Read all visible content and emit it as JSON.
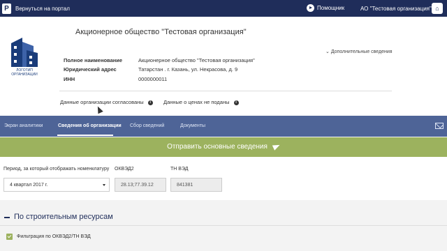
{
  "topbar": {
    "back_label": "Вернуться на портал",
    "helper_label": "Помощник",
    "org_label": "АО \"Тестовая организация\"",
    "logo_letter": "P",
    "user_glyph": "⌂"
  },
  "org": {
    "title": "Акционерное общество \"Тестовая организация\"",
    "logo_caption": "ЛОГОТИП ОРГАНИЗАЦИИ",
    "more_label": "Дополнительные сведения",
    "fields": [
      {
        "key": "Полное наименование",
        "value": "Акционерное общество \"Тестовая организация\""
      },
      {
        "key": "Юридический адрес",
        "value": "Татарстан . г. Казань, ул. Некрасова, д. 9"
      },
      {
        "key": "ИНН",
        "value": "0000000011"
      }
    ],
    "status_agreed": "Данные организации согласованы",
    "status_prices": "Данные о ценах не поданы"
  },
  "tabs": [
    {
      "label": "Экран аналитики",
      "active": false
    },
    {
      "label": "Сведения об организации",
      "active": true
    },
    {
      "label": "Сбор сведений",
      "active": false
    },
    {
      "label": "Документы",
      "active": false
    }
  ],
  "send_button": "Отправить основные сведения",
  "filters": {
    "period_label": "Период, за который отображать номенклатуру",
    "period_value": "4 квартал 2017 г.",
    "okved_label": "ОКВЭД2",
    "okved_value": "28.13;77.39.12",
    "tnved_label": "ТН ВЭД",
    "tnved_value": "841381"
  },
  "section": {
    "title": "По строительным ресурсам",
    "checkbox_label": "Фильтрация по ОКВЭД2/ТН ВЭД",
    "checked": true
  },
  "colors": {
    "topbar": "#1f2d5a",
    "tabs": "#4e6497",
    "send": "#9cb25e"
  }
}
